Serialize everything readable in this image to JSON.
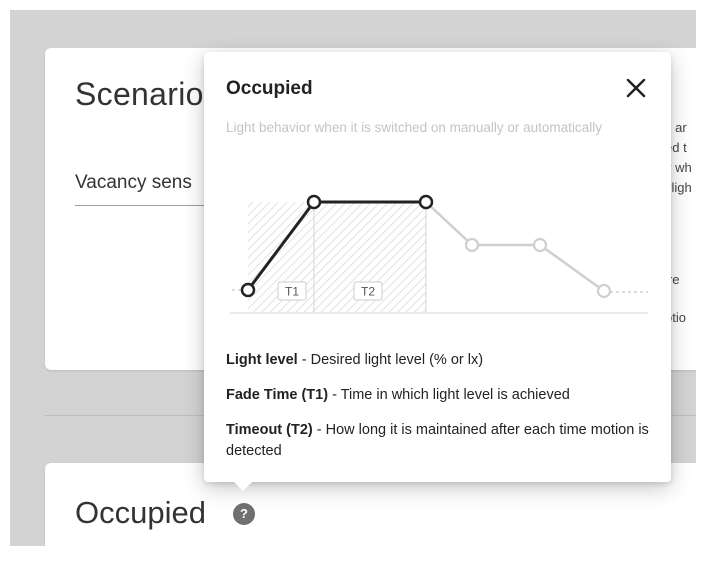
{
  "background": {
    "scenario_title": "Scenario",
    "vacancy_label": "Vacancy sens",
    "right_fragments": [
      "s ar",
      "ed t",
      "v wh",
      "vligh",
      "ire",
      "otio"
    ],
    "occupied_heading": "Occupied",
    "help_icon": "?"
  },
  "popup": {
    "title": "Occupied",
    "subtitle": "Light behavior when it is switched on manually or automatically",
    "close_icon": "close-icon",
    "chart_labels": {
      "t1": "T1",
      "t2": "T2"
    },
    "definitions": [
      {
        "term": "Light level",
        "desc": " - Desired light level (% or lx)"
      },
      {
        "term": "Fade Time (T1)",
        "desc": " - Time in which light level is achieved"
      },
      {
        "term": "Timeout (T2)",
        "desc": " - How long it is maintained after each time motion is detected"
      }
    ]
  },
  "colors": {
    "primary_line": "#222222",
    "faded_line": "#cfcfcf",
    "subtitle": "#c4c4c4"
  }
}
